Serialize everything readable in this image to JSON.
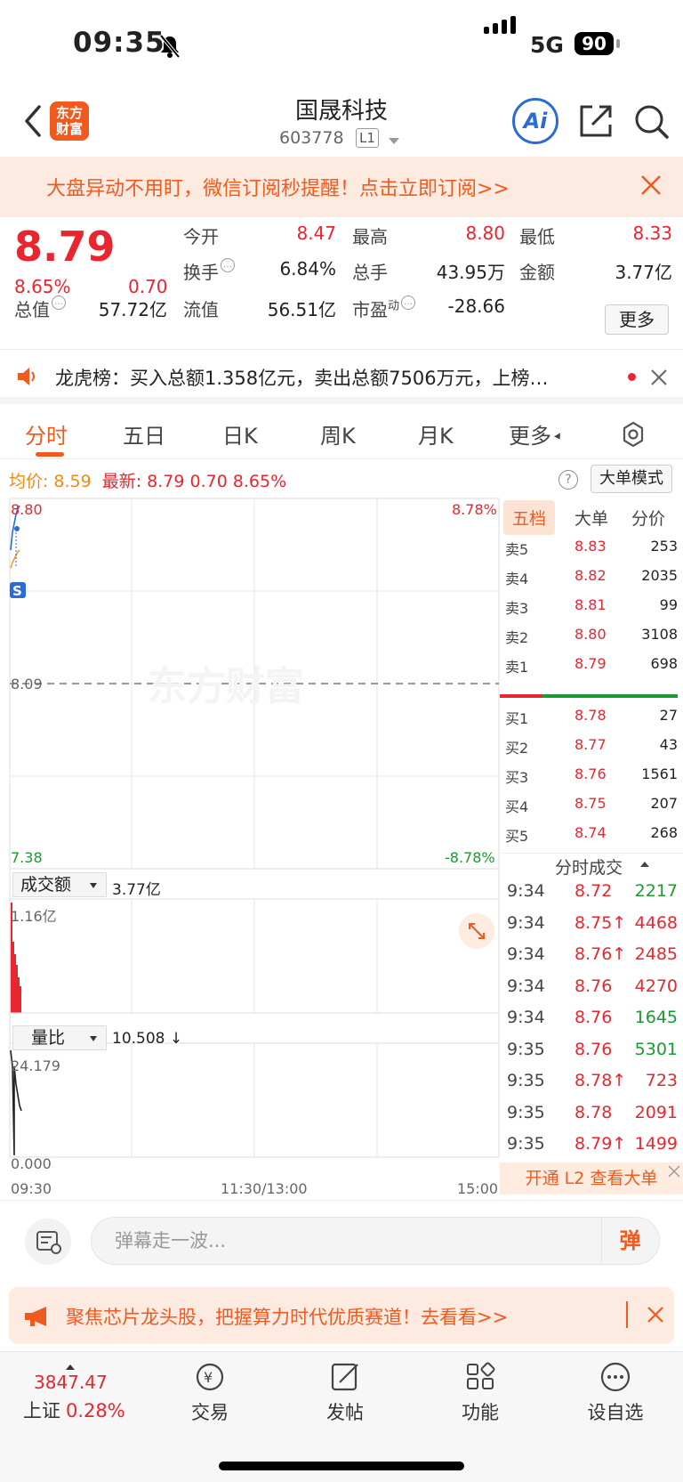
{
  "status_bar": {
    "time": "09:35",
    "network": "5G",
    "battery": "90"
  },
  "header": {
    "logo": "东方财富",
    "title": "国晟科技",
    "code": "603778",
    "level": "L1",
    "ai": "Ai"
  },
  "banner": {
    "text": "大盘异动不用盯，微信订阅秒提醒！点击立即订阅>>"
  },
  "quote": {
    "price": "8.79",
    "change_pct": "8.65%",
    "change": "0.70",
    "open_label": "今开",
    "open": "8.47",
    "high_label": "最高",
    "high": "8.80",
    "low_label": "最低",
    "low": "8.33",
    "turnover_label": "换手",
    "turnover": "6.84%",
    "volume_label": "总手",
    "volume": "43.95万",
    "amount_label": "金额",
    "amount": "3.77亿",
    "mktcap_label": "总值",
    "mktcap": "57.72亿",
    "float_label": "流值",
    "float": "56.51亿",
    "pe_label": "市盈",
    "pe_sup": "动",
    "pe": "-28.66",
    "more": "更多"
  },
  "dragon_tiger": {
    "text": "龙虎榜：买入总额1.358亿元，卖出总额7506万元，上榜…"
  },
  "tabs": [
    "分时",
    "五日",
    "日K",
    "周K",
    "月K",
    "更多"
  ],
  "chart": {
    "avg_label": "均价:",
    "avg": "8.59",
    "last_label": "最新:",
    "last": "8.79",
    "last_chg": "0.70",
    "last_pct": "8.65%",
    "big_mode": "大单模式",
    "y_max": "8.80",
    "y_max_pct": "8.78%",
    "y_mid": "8.09",
    "y_min": "7.38",
    "y_min_pct": "-8.78%",
    "watermark": "东方财富",
    "marker": "S",
    "ind1_label": "成交额",
    "ind1_value": "3.77亿",
    "ind1_max": "1.16亿",
    "ind2_label": "量比",
    "ind2_value": "10.508 ↓",
    "ind2_max": "24.179",
    "ind2_min": "0.000",
    "x_start": "09:30",
    "x_mid": "11:30/13:00",
    "x_end": "15:00"
  },
  "order_book": {
    "tabs": [
      "五档",
      "大单",
      "分价"
    ],
    "asks": [
      {
        "name": "卖5",
        "price": "8.83",
        "vol": "253"
      },
      {
        "name": "卖4",
        "price": "8.82",
        "vol": "2035"
      },
      {
        "name": "卖3",
        "price": "8.81",
        "vol": "99"
      },
      {
        "name": "卖2",
        "price": "8.80",
        "vol": "3108"
      },
      {
        "name": "卖1",
        "price": "8.79",
        "vol": "698"
      }
    ],
    "bids": [
      {
        "name": "买1",
        "price": "8.78",
        "vol": "27"
      },
      {
        "name": "买2",
        "price": "8.77",
        "vol": "43"
      },
      {
        "name": "买3",
        "price": "8.76",
        "vol": "1561"
      },
      {
        "name": "买4",
        "price": "8.75",
        "vol": "207"
      },
      {
        "name": "买5",
        "price": "8.74",
        "vol": "268"
      }
    ],
    "ticks_title": "分时成交",
    "ticks": [
      {
        "time": "9:34",
        "price": "8.72",
        "vol": "2217",
        "color": "#1a9a32"
      },
      {
        "time": "9:34",
        "price": "8.75↑",
        "vol": "4468",
        "color": "#e8262f"
      },
      {
        "time": "9:34",
        "price": "8.76↑",
        "vol": "2485",
        "color": "#e8262f"
      },
      {
        "time": "9:34",
        "price": "8.76",
        "vol": "4270",
        "color": "#e8262f"
      },
      {
        "time": "9:34",
        "price": "8.76",
        "vol": "1645",
        "color": "#1a9a32"
      },
      {
        "time": "9:35",
        "price": "8.76",
        "vol": "5301",
        "color": "#1a9a32"
      },
      {
        "time": "9:35",
        "price": "8.78↑",
        "vol": "723",
        "color": "#e8262f"
      },
      {
        "time": "9:35",
        "price": "8.78",
        "vol": "2091",
        "color": "#e8262f"
      },
      {
        "time": "9:35",
        "price": "8.79↑",
        "vol": "1499",
        "color": "#e8262f"
      }
    ],
    "l2": "开通 L2 查看大单"
  },
  "comment": {
    "placeholder": "弹幕走一波...",
    "dan": "弹"
  },
  "promo": {
    "text": "聚焦芯片龙头股，把握算力时代优质赛道！去看看>>"
  },
  "tabbar": {
    "index_value": "3847.47",
    "index_name": "上证",
    "index_change": "0.28%",
    "items": [
      "交易",
      "发帖",
      "功能",
      "设自选"
    ]
  },
  "colors": {
    "up": "#e8262f",
    "down": "#1a9a32",
    "accent": "#f05a1e"
  }
}
